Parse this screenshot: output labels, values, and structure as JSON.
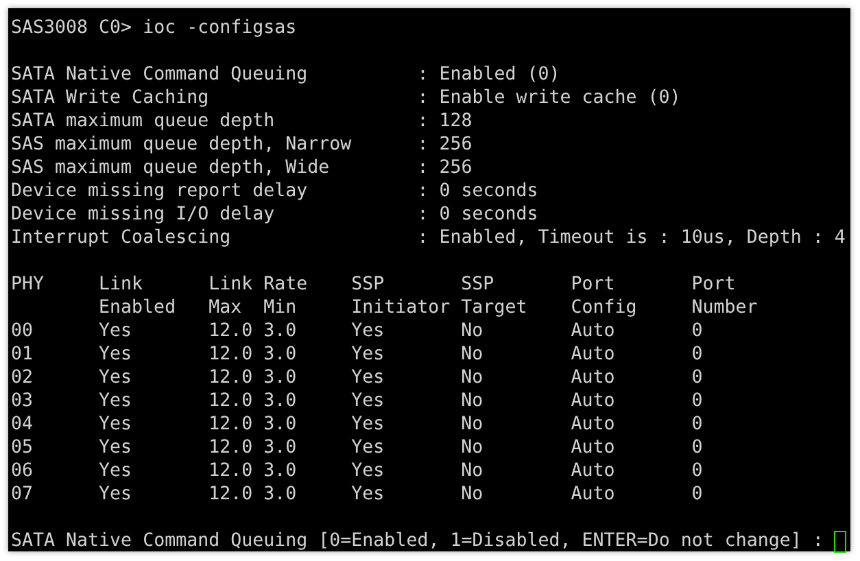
{
  "terminal": {
    "prompt": "SAS3008 C0>",
    "command": "ioc -configsas",
    "settings": [
      {
        "label": "SATA Native Command Queuing",
        "value": ": Enabled (0)"
      },
      {
        "label": "SATA Write Caching",
        "value": ": Enable write cache (0)"
      },
      {
        "label": "SATA maximum queue depth",
        "value": ": 128"
      },
      {
        "label": "SAS maximum queue depth, Narrow",
        "value": ": 256"
      },
      {
        "label": "SAS maximum queue depth, Wide",
        "value": ": 256"
      },
      {
        "label": "Device missing report delay",
        "value": ": 0 seconds"
      },
      {
        "label": "Device missing I/O delay",
        "value": ": 0 seconds"
      },
      {
        "label": "Interrupt Coalescing",
        "value": ": Enabled, Timeout is : 10us, Depth : 4"
      }
    ],
    "table": {
      "header_rows": [
        [
          "PHY",
          "Link",
          "Link",
          "Rate",
          "SSP",
          "SSP",
          "Port",
          "Port"
        ],
        [
          null,
          "Enabled",
          "Max",
          "Min",
          "Initiator",
          "Target",
          "Config",
          "Number"
        ]
      ],
      "rows": [
        [
          "00",
          "Yes",
          "12.0",
          "3.0",
          "Yes",
          "No",
          "Auto",
          "0"
        ],
        [
          "01",
          "Yes",
          "12.0",
          "3.0",
          "Yes",
          "No",
          "Auto",
          "0"
        ],
        [
          "02",
          "Yes",
          "12.0",
          "3.0",
          "Yes",
          "No",
          "Auto",
          "0"
        ],
        [
          "03",
          "Yes",
          "12.0",
          "3.0",
          "Yes",
          "No",
          "Auto",
          "0"
        ],
        [
          "04",
          "Yes",
          "12.0",
          "3.0",
          "Yes",
          "No",
          "Auto",
          "0"
        ],
        [
          "05",
          "Yes",
          "12.0",
          "3.0",
          "Yes",
          "No",
          "Auto",
          "0"
        ],
        [
          "06",
          "Yes",
          "12.0",
          "3.0",
          "Yes",
          "No",
          "Auto",
          "0"
        ],
        [
          "07",
          "Yes",
          "12.0",
          "3.0",
          "Yes",
          "No",
          "Auto",
          "0"
        ]
      ]
    },
    "question": "SATA Native Command Queuing [0=Enabled, 1=Disabled, ENTER=Do not change] :"
  }
}
